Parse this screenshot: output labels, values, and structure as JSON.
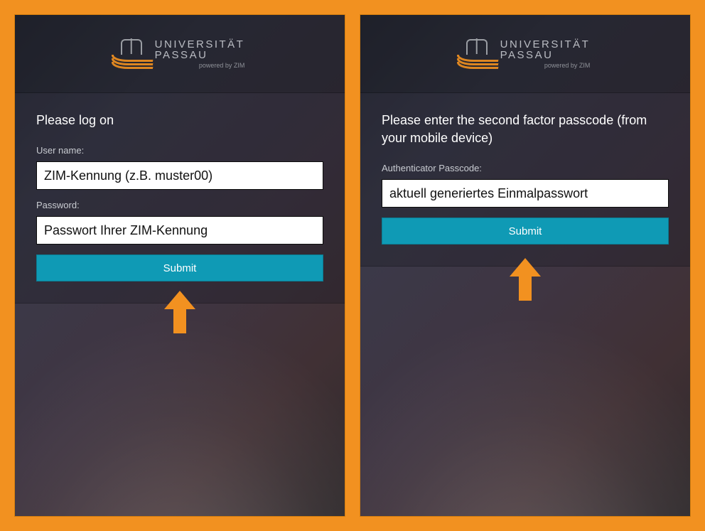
{
  "logo": {
    "line1": "UNIVERSITÄT",
    "line2": "PASSAU",
    "subline": "powered by ZIM"
  },
  "left": {
    "heading": "Please log on",
    "username_label": "User name:",
    "username_value": "ZIM-Kennung (z.B. muster00)",
    "password_label": "Password:",
    "password_value": "Passwort Ihrer ZIM-Kennung",
    "submit_label": "Submit"
  },
  "right": {
    "heading": "Please enter the second factor passcode (from your mobile device)",
    "passcode_label": "Authenticator Passcode:",
    "passcode_value": "aktuell generiertes Einmalpasswort",
    "submit_label": "Submit"
  },
  "colors": {
    "accent": "#f29120",
    "button": "#0f9ab5"
  }
}
